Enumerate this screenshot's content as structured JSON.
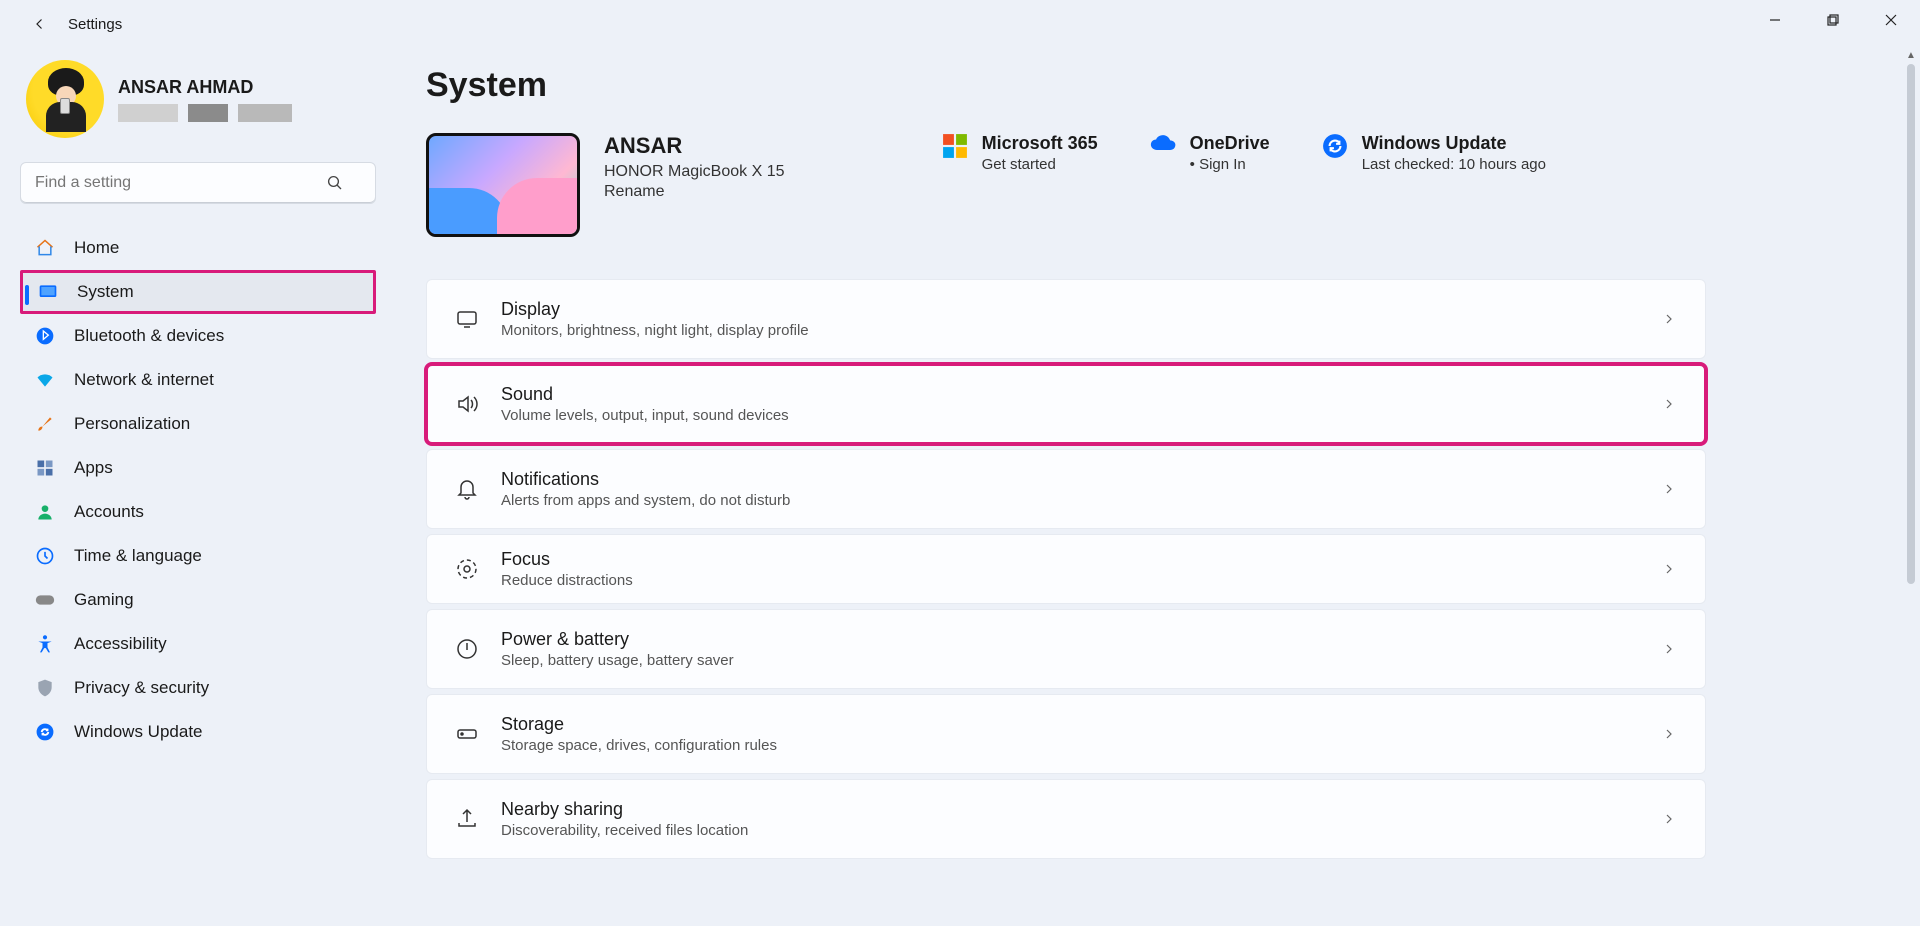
{
  "window": {
    "title": "Settings"
  },
  "profile": {
    "name": "ANSAR AHMAD"
  },
  "search": {
    "placeholder": "Find a setting"
  },
  "nav": {
    "home": "Home",
    "system": "System",
    "bluetooth": "Bluetooth & devices",
    "network": "Network & internet",
    "personalization": "Personalization",
    "apps": "Apps",
    "accounts": "Accounts",
    "time": "Time & language",
    "gaming": "Gaming",
    "accessibility": "Accessibility",
    "privacy": "Privacy & security",
    "update": "Windows Update"
  },
  "page": {
    "title": "System"
  },
  "device": {
    "name": "ANSAR",
    "model": "HONOR MagicBook X 15",
    "rename": "Rename"
  },
  "cards": {
    "m365": {
      "title": "Microsoft 365",
      "sub": "Get started"
    },
    "onedrive": {
      "title": "OneDrive",
      "sub": "Sign In"
    },
    "wupdate": {
      "title": "Windows Update",
      "sub": "Last checked: 10 hours ago"
    }
  },
  "settings": {
    "display": {
      "title": "Display",
      "sub": "Monitors, brightness, night light, display profile"
    },
    "sound": {
      "title": "Sound",
      "sub": "Volume levels, output, input, sound devices"
    },
    "notifications": {
      "title": "Notifications",
      "sub": "Alerts from apps and system, do not disturb"
    },
    "focus": {
      "title": "Focus",
      "sub": "Reduce distractions"
    },
    "power": {
      "title": "Power & battery",
      "sub": "Sleep, battery usage, battery saver"
    },
    "storage": {
      "title": "Storage",
      "sub": "Storage space, drives, configuration rules"
    },
    "nearby": {
      "title": "Nearby sharing",
      "sub": "Discoverability, received files location"
    }
  }
}
